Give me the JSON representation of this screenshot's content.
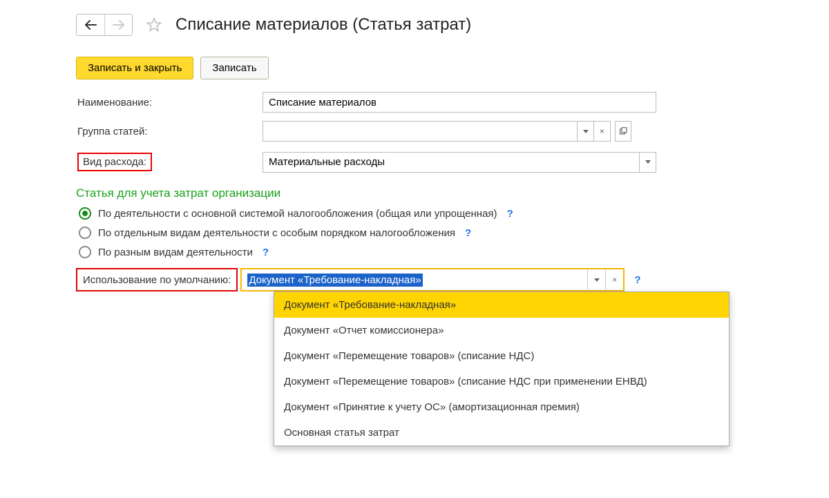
{
  "header": {
    "title": "Списание материалов (Статья затрат)"
  },
  "toolbar": {
    "save_close": "Записать и закрыть",
    "save": "Записать"
  },
  "fields": {
    "name_label": "Наименование:",
    "name_value": "Списание материалов",
    "group_label": "Группа статей:",
    "group_value": "",
    "expense_type_label": "Вид расхода:",
    "expense_type_value": "Материальные расходы"
  },
  "section": {
    "heading": "Статья для учета затрат организации",
    "radios": [
      {
        "label": "По деятельности с основной системой налогообложения (общая или упрощенная)",
        "checked": true
      },
      {
        "label": "По отдельным видам деятельности с особым порядком налогообложения",
        "checked": false
      },
      {
        "label": "По разным видам деятельности",
        "checked": false
      }
    ]
  },
  "usage": {
    "label": "Использование по умолчанию:",
    "value": "Документ «Требование-накладная»",
    "options": [
      "Документ «Требование-накладная»",
      "Документ «Отчет комиссионера»",
      "Документ «Перемещение товаров» (списание НДС)",
      "Документ «Перемещение товаров» (списание НДС при применении ЕНВД)",
      "Документ «Принятие к учету ОС» (амортизационная премия)",
      "Основная статья затрат"
    ]
  },
  "help_symbol": "?"
}
